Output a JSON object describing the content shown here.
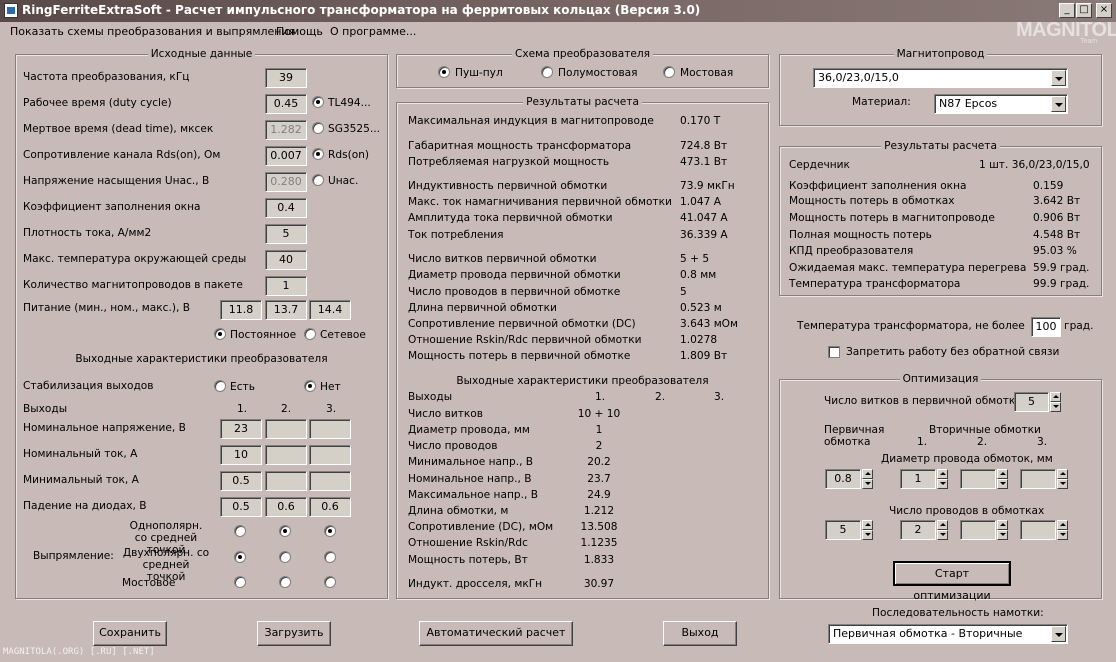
{
  "window": {
    "title": "RingFerriteExtraSoft - Расчет импульсного трансформатора на ферритовых кольцах (Версия 3.0)",
    "min": "_",
    "max": "□",
    "close": "×"
  },
  "logo": {
    "text": "MAGNITOLA",
    "sub": "Team"
  },
  "menu": [
    "Показать схемы преобразования и выпрямления",
    "Помощь",
    "О программе..."
  ],
  "input": {
    "title": "Исходные данные",
    "rows": [
      {
        "label": "Частота преобразования, кГц",
        "value": "39"
      },
      {
        "label": "Рабочее время (duty cycle)",
        "value": "0.45",
        "opt": "TL494..."
      },
      {
        "label": "Мертвое время (dead time), мксек",
        "value": "1.282",
        "opt": "SG3525..."
      },
      {
        "label": "Сопротивление канала Rds(on), Ом",
        "value": "0.007",
        "opt": "Rds(on)"
      },
      {
        "label": "Напряжение насыщения Uнас., В",
        "value": "0.280",
        "opt": "Uнас."
      },
      {
        "label": "Коэффициент заполнения окна",
        "value": "0.4"
      },
      {
        "label": "Плотность тока, А/мм2",
        "value": "5"
      },
      {
        "label": "Макс. температура окружающей среды",
        "value": "40"
      },
      {
        "label": "Количество магнитопроводов  в пакете",
        "value": "1"
      }
    ],
    "supply_label": "Питание (мин., ном., макс.), В",
    "supply": [
      "11.8",
      "13.7",
      "14.4"
    ],
    "dc": "Постоянное",
    "ac": "Сетевое"
  },
  "outputs": {
    "title": "Выходные характеристики преобразователя",
    "stab_label": "Стабилизация выходов",
    "stab_yes": "Есть",
    "stab_no": "Нет",
    "outs_label": "Выходы",
    "cols": [
      "1.",
      "2.",
      "3."
    ],
    "rows": [
      {
        "label": "Номинальное напряжение, В",
        "values": [
          "23",
          "",
          ""
        ]
      },
      {
        "label": "Номинальный ток, А",
        "values": [
          "10",
          "",
          ""
        ]
      },
      {
        "label": "Минимальный ток, А",
        "values": [
          "0.5",
          "",
          ""
        ]
      },
      {
        "label": "Падение на диодах, В",
        "values": [
          "0.5",
          "0.6",
          "0.6"
        ]
      }
    ],
    "rect_label": "Выпрямление:",
    "rect1": "Однополярн. со средней точкой",
    "rect2": "Двухполярн. со средней точкой",
    "rect3": "Мостовое"
  },
  "scheme": {
    "title": "Схема преобразователя",
    "opts": [
      "Пуш-пул",
      "Полумостовая",
      "Мостовая"
    ]
  },
  "results": {
    "title": "Результаты расчета",
    "rows": [
      {
        "label": "Максимальная индукция в магнитопроводе",
        "value": "0.170 Т"
      },
      {
        "label": "Габаритная мощность трансформатора",
        "value": "724.8 Вт"
      },
      {
        "label": "Потребляемая нагрузкой мощность",
        "value": "473.1 Вт"
      },
      {
        "label": "Индуктивность первичной обмотки",
        "value": "73.9 мкГн"
      },
      {
        "label": "Макс. ток намагничивания первичной обмотки",
        "value": "1.047 А"
      },
      {
        "label": "Амплитуда тока первичной обмотки",
        "value": "41.047 А"
      },
      {
        "label": "Ток потребления",
        "value": "36.339 А"
      },
      {
        "label": "Число витков первичной обмотки",
        "value": "5 + 5"
      },
      {
        "label": "Диаметр провода первичной обмотки",
        "value": "0.8 мм"
      },
      {
        "label": "Число проводов в первичной обмотке",
        "value": "5"
      },
      {
        "label": "Длина  первичной обмотки",
        "value": "0.523 м"
      },
      {
        "label": "Сопротивление первичной обмотки (DC)",
        "value": "3.643 мОм"
      },
      {
        "label": "Отношение Rskin/Rdc первичной обмотки",
        "value": "1.0278"
      },
      {
        "label": "Мощность потерь в первичной обмотке",
        "value": "1.809 Вт"
      }
    ],
    "out_title": "Выходные характеристики преобразователя",
    "out_head": "Выходы",
    "out_cols": [
      "1.",
      "2.",
      "3."
    ],
    "out_rows": [
      {
        "label": "Число витков",
        "value": "10 + 10"
      },
      {
        "label": "Диаметр провода, мм",
        "value": "1"
      },
      {
        "label": "Число проводов",
        "value": "2"
      },
      {
        "label": "Минимальное напр., В",
        "value": "20.2"
      },
      {
        "label": "Номинальное напр., В",
        "value": "23.7"
      },
      {
        "label": "Максимальное напр., В",
        "value": "24.9"
      },
      {
        "label": "Длина обмотки, м",
        "value": "1.212"
      },
      {
        "label": "Сопротивление (DC), мОм",
        "value": "13.508"
      },
      {
        "label": "Отношение Rskin/Rdc",
        "value": "1.1235"
      },
      {
        "label": "Мощность потерь, Вт",
        "value": "1.833"
      },
      {
        "label": "Индукт. дросселя, мкГн",
        "value": "30.97"
      }
    ]
  },
  "core": {
    "title": "Магнитопровод",
    "size": "36,0/23,0/15,0",
    "mat_label": "Материал:",
    "material": "N87 Epcos"
  },
  "core_results": {
    "title": "Результаты расчета",
    "rows": [
      {
        "label": "Сердечник",
        "value": "1 шт. 36,0/23,0/15,0"
      },
      {
        "label": "Коэффициент заполнения окна",
        "value": "0.159"
      },
      {
        "label": "Мощность потерь в обмотках",
        "value": "3.642 Вт"
      },
      {
        "label": "Мощность потерь в магнитопроводе",
        "value": "0.906 Вт"
      },
      {
        "label": "Полная мощность потерь",
        "value": "4.548 Вт"
      },
      {
        "label": "КПД преобразователя",
        "value": "95.03 %"
      },
      {
        "label": "Ожидаемая макс. температура перегрева",
        "value": "59.9 град."
      },
      {
        "label": "Температура трансформатора",
        "value": "99.9 град."
      }
    ]
  },
  "temp": {
    "label": "Температура трансформатора, не более",
    "value": "100",
    "unit": "град.",
    "nofb": "Запретить работу без обратной связи"
  },
  "optim": {
    "title": "Оптимизация",
    "turns_label": "Число витков в первичной обмотке",
    "turns": "5",
    "prim": "Первичная обмотка",
    "sec": "Вторичные обмотки",
    "cols": [
      "1.",
      "2.",
      "3."
    ],
    "diam_label": "Диаметр провода обмоток, мм",
    "diam": [
      "0.8",
      "1",
      "",
      ""
    ],
    "wires_label": "Число проводов в обмотках",
    "wires": [
      "5",
      "2",
      "",
      ""
    ],
    "start": "Старт оптимизации"
  },
  "seq": {
    "label": "Последовательность намотки:",
    "value": "Первичная обмотка - Вторичные обмотки"
  },
  "buttons": {
    "save": "Сохранить",
    "load": "Загрузить",
    "auto": "Автоматический расчет",
    "exit": "Выход"
  },
  "footer": "MAGNITOLA(.ORG) [.RU] [.NET]"
}
